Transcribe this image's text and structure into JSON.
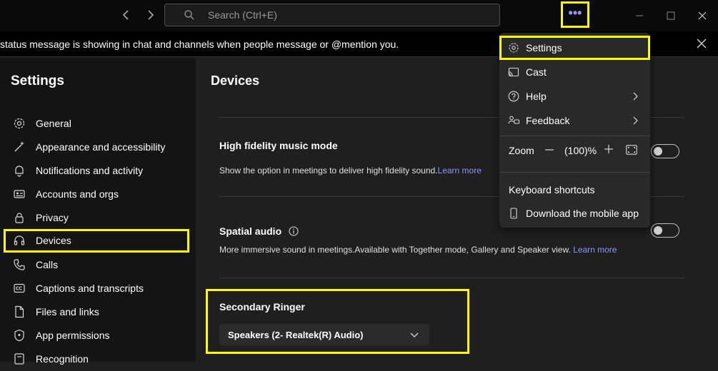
{
  "search": {
    "placeholder": "Search (Ctrl+E)"
  },
  "topbar": {
    "more_label": "•••"
  },
  "banner": {
    "message": "status message is showing in chat and channels when people message or @mention you."
  },
  "sidebar": {
    "title": "Settings",
    "items": [
      {
        "label": "General",
        "icon": "gear-icon"
      },
      {
        "label": "Appearance and accessibility",
        "icon": "magic-wand-icon"
      },
      {
        "label": "Notifications and activity",
        "icon": "bell-icon"
      },
      {
        "label": "Accounts and orgs",
        "icon": "id-card-icon"
      },
      {
        "label": "Privacy",
        "icon": "lock-icon"
      },
      {
        "label": "Devices",
        "icon": "headset-icon",
        "selected": true
      },
      {
        "label": "Calls",
        "icon": "phone-icon"
      },
      {
        "label": "Captions and transcripts",
        "icon": "captions-icon"
      },
      {
        "label": "Files and links",
        "icon": "file-icon"
      },
      {
        "label": "App permissions",
        "icon": "shield-icon"
      },
      {
        "label": "Recognition",
        "icon": "recognition-icon"
      }
    ]
  },
  "main": {
    "title": "Devices",
    "hifi": {
      "title": "High fidelity music mode",
      "desc": "Show the option in meetings to deliver high fidelity sound.",
      "link": "Learn more",
      "enabled": false
    },
    "spatial": {
      "title": "Spatial audio",
      "desc": "More immersive sound in meetings.Available with Together mode, Gallery and Speaker view.",
      "link": "Learn more",
      "enabled": false
    },
    "ringer": {
      "title": "Secondary Ringer",
      "selected": "Speakers (2- Realtek(R) Audio)"
    }
  },
  "menu": {
    "settings": "Settings",
    "cast": "Cast",
    "help": "Help",
    "feedback": "Feedback",
    "zoom_label": "Zoom",
    "zoom_value": "(100)%",
    "shortcuts": "Keyboard shortcuts",
    "mobile": "Download the mobile app"
  },
  "colors": {
    "highlight": "#ffff00",
    "accent": "#8f95ff",
    "background": "#1f1f1f",
    "sidebar": "#141414"
  }
}
